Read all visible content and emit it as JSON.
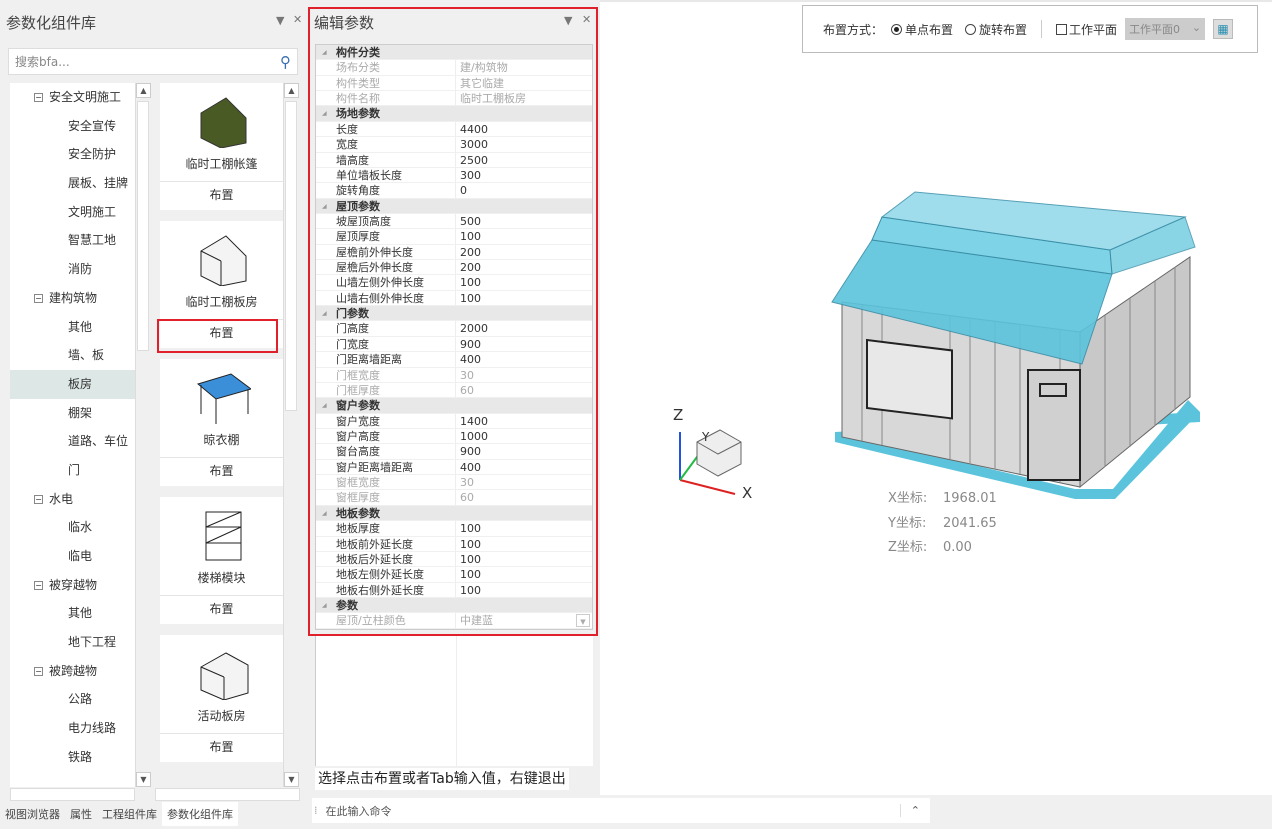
{
  "left_panel": {
    "title": "参数化组件库",
    "search_placeholder": "搜索bfa...",
    "tree": [
      {
        "label": "安全文明施工",
        "type": "group"
      },
      {
        "label": "安全宣传"
      },
      {
        "label": "安全防护"
      },
      {
        "label": "展板、挂牌"
      },
      {
        "label": "文明施工"
      },
      {
        "label": "智慧工地"
      },
      {
        "label": "消防"
      },
      {
        "label": "建构筑物",
        "type": "group"
      },
      {
        "label": "其他"
      },
      {
        "label": "墙、板"
      },
      {
        "label": "板房",
        "selected": true
      },
      {
        "label": "棚架"
      },
      {
        "label": "道路、车位"
      },
      {
        "label": "门"
      },
      {
        "label": "水电",
        "type": "group"
      },
      {
        "label": "临水"
      },
      {
        "label": "临电"
      },
      {
        "label": "被穿越物",
        "type": "group"
      },
      {
        "label": "其他"
      },
      {
        "label": "地下工程"
      },
      {
        "label": "被跨越物",
        "type": "group"
      },
      {
        "label": "公路"
      },
      {
        "label": "电力线路"
      },
      {
        "label": "铁路"
      }
    ],
    "cards": [
      {
        "label": "临时工棚帐篷",
        "button": "布置"
      },
      {
        "label": "临时工棚板房",
        "button": "布置",
        "highlighted": true
      },
      {
        "label": "晾衣棚",
        "button": "布置"
      },
      {
        "label": "楼梯模块",
        "button": "布置"
      },
      {
        "label": "活动板房",
        "button": "布置"
      }
    ],
    "tabs": [
      "视图浏览器",
      "属性",
      "工程组件库",
      "参数化组件库"
    ],
    "active_tab": "参数化组件库"
  },
  "edit_panel": {
    "title": "编辑参数",
    "groups": [
      {
        "name": "构件分类",
        "rows": [
          [
            "场布分类",
            "建/构筑物",
            true
          ],
          [
            "构件类型",
            "其它临建",
            true
          ],
          [
            "构件名称",
            "临时工棚板房",
            true
          ]
        ]
      },
      {
        "name": "场地参数",
        "rows": [
          [
            "长度",
            "4400"
          ],
          [
            "宽度",
            "3000"
          ],
          [
            "墙高度",
            "2500"
          ],
          [
            "单位墙板长度",
            "300"
          ],
          [
            "旋转角度",
            "0"
          ]
        ]
      },
      {
        "name": "屋顶参数",
        "rows": [
          [
            "坡屋顶高度",
            "500"
          ],
          [
            "屋顶厚度",
            "100"
          ],
          [
            "屋檐前外伸长度",
            "200"
          ],
          [
            "屋檐后外伸长度",
            "200"
          ],
          [
            "山墙左侧外伸长度",
            "100"
          ],
          [
            "山墙右侧外伸长度",
            "100"
          ]
        ]
      },
      {
        "name": "门参数",
        "rows": [
          [
            "门高度",
            "2000"
          ],
          [
            "门宽度",
            "900"
          ],
          [
            "门距离墙距离",
            "400"
          ],
          [
            "门框宽度",
            "30",
            true
          ],
          [
            "门框厚度",
            "60",
            true
          ]
        ]
      },
      {
        "name": "窗户参数",
        "rows": [
          [
            "窗户宽度",
            "1400"
          ],
          [
            "窗户高度",
            "1000"
          ],
          [
            "窗台高度",
            "900"
          ],
          [
            "窗户距离墙距离",
            "400"
          ],
          [
            "窗框宽度",
            "30",
            true
          ],
          [
            "窗框厚度",
            "60",
            true
          ]
        ]
      },
      {
        "name": "地板参数",
        "rows": [
          [
            "地板厚度",
            "100"
          ],
          [
            "地板前外延长度",
            "100"
          ],
          [
            "地板后外延长度",
            "100"
          ],
          [
            "地板左侧外延长度",
            "100"
          ],
          [
            "地板右侧外延长度",
            "100"
          ]
        ]
      },
      {
        "name": "参数",
        "rows": [
          [
            "屋顶/立柱颜色",
            "中建蓝",
            true
          ]
        ]
      }
    ],
    "hint": "选择点击布置或者Tab输入值，右键退出"
  },
  "command": {
    "placeholder": "在此输入命令"
  },
  "toolbar": {
    "mode_label": "布置方式：",
    "single": "单点布置",
    "rotate": "旋转布置",
    "selected_mode": "单点布置",
    "workplane_label": "工作平面",
    "workplane_checked": false,
    "workplane_value": "工作平面0"
  },
  "viewport": {
    "axis_x": "X",
    "axis_y": "Y",
    "axis_z": "Z",
    "coords": [
      {
        "label": "X坐标:",
        "value": "1968.01"
      },
      {
        "label": "Y坐标:",
        "value": "2041.65"
      },
      {
        "label": "Z坐标:",
        "value": "0.00"
      }
    ],
    "roof_color": "#5bc4dc"
  },
  "colors": {
    "highlight": "#e0202a",
    "selected_tree": "#dde8e6"
  }
}
